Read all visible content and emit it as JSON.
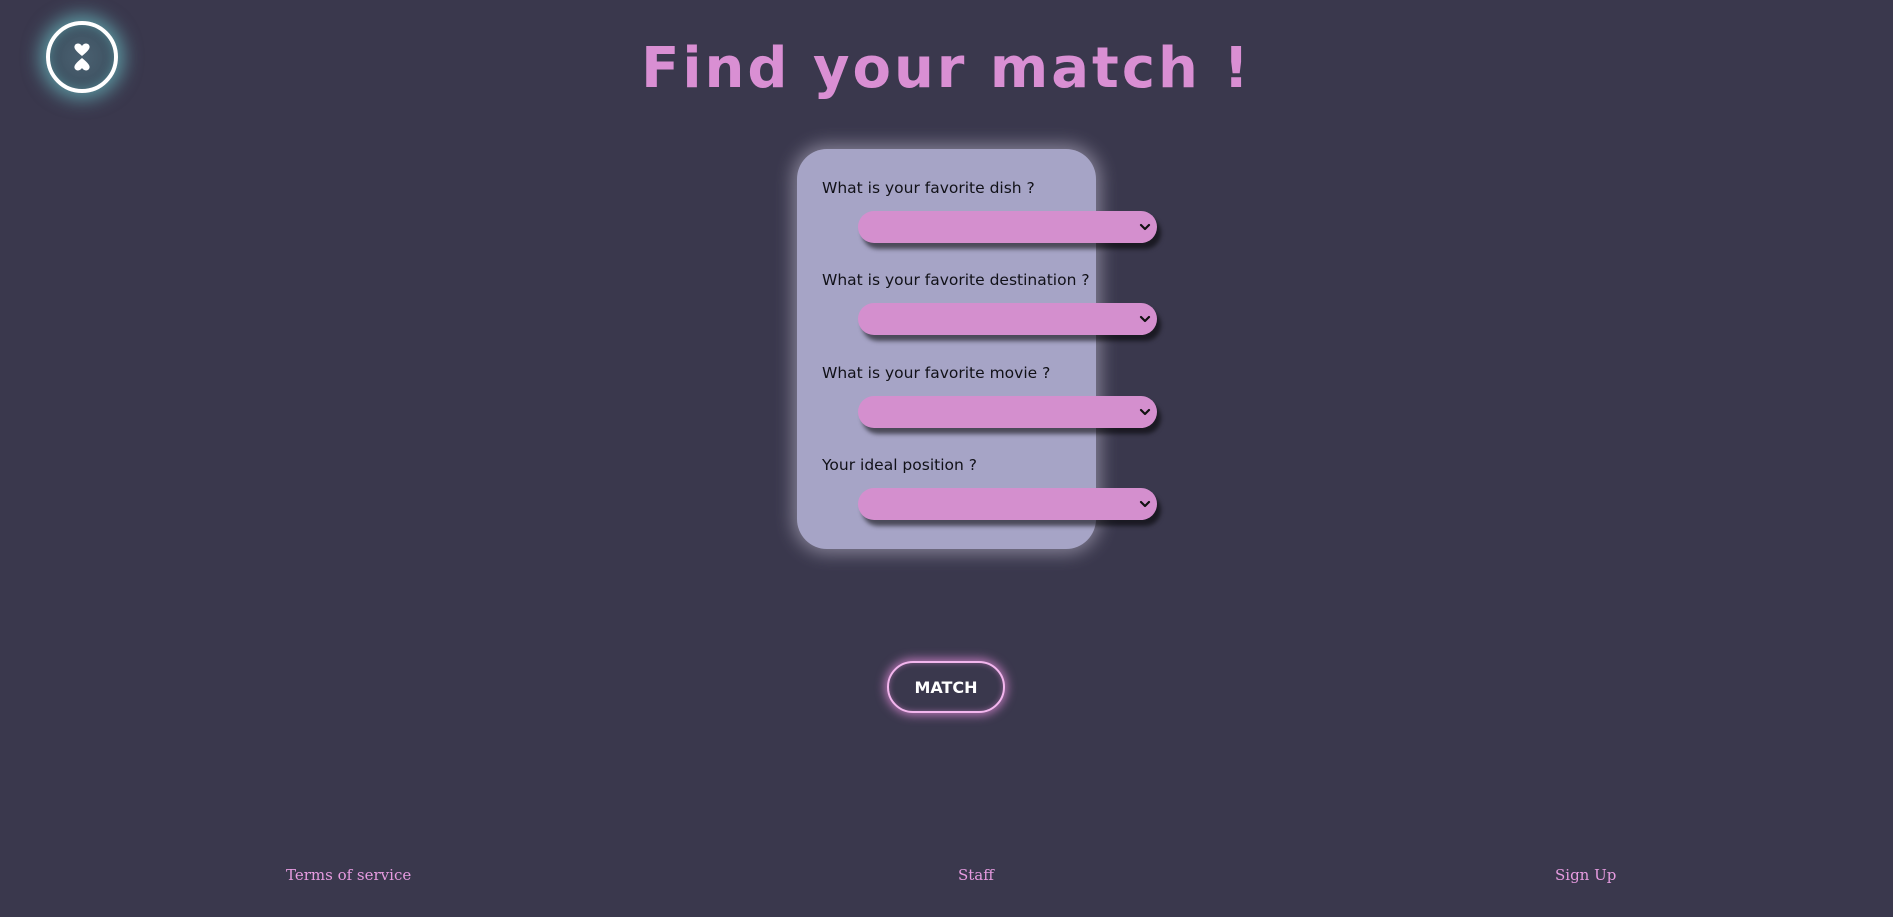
{
  "header": {
    "logo_icon": "hourglass-hearts-icon",
    "title": "Find your match !"
  },
  "form": {
    "questions": [
      {
        "label": "What is your favorite dish ?",
        "value": ""
      },
      {
        "label": "What is your favorite destination ?",
        "value": ""
      },
      {
        "label": "What is your favorite movie ?",
        "value": ""
      },
      {
        "label": "Your ideal position ?",
        "value": ""
      }
    ],
    "chevron_icon": "chevron-down-icon"
  },
  "actions": {
    "match_label": "MATCH"
  },
  "footer": {
    "terms_label": "Terms of service",
    "staff_label": "Staff",
    "signup_label": "Sign Up"
  },
  "colors": {
    "background": "#3a384d",
    "accent": "#d98fd3",
    "card": "#a6a4c6",
    "select": "#d48fce",
    "logo_glow": "#78e6e6"
  }
}
